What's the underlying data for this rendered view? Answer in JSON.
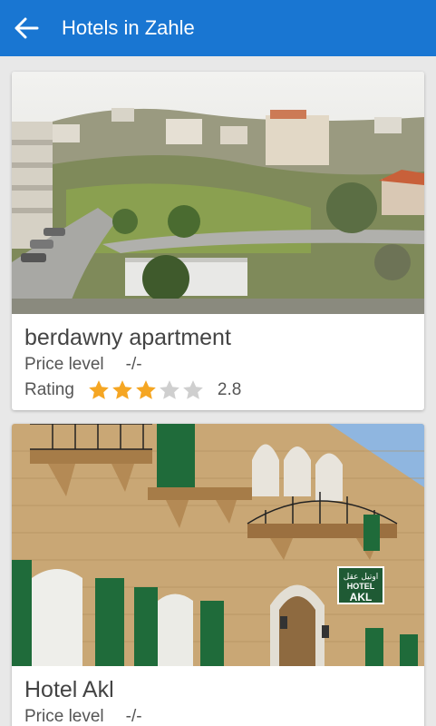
{
  "appbar": {
    "title": "Hotels in Zahle"
  },
  "hotels": [
    {
      "name": "berdawny apartment",
      "price_label": "Price level",
      "price_value": "-/-",
      "rating_label": "Rating",
      "rating_value": "2.8",
      "rating_stars": 3
    },
    {
      "name": "Hotel Akl",
      "price_label": "Price level",
      "price_value": "-/-",
      "sign_text_top": "اوتيل عقل",
      "sign_text_hotel": "HOTEL",
      "sign_text_name": "AKL"
    }
  ],
  "colors": {
    "appbar": "#1976d2",
    "star_filled": "#f5a623",
    "star_empty": "#cfcfcf"
  }
}
